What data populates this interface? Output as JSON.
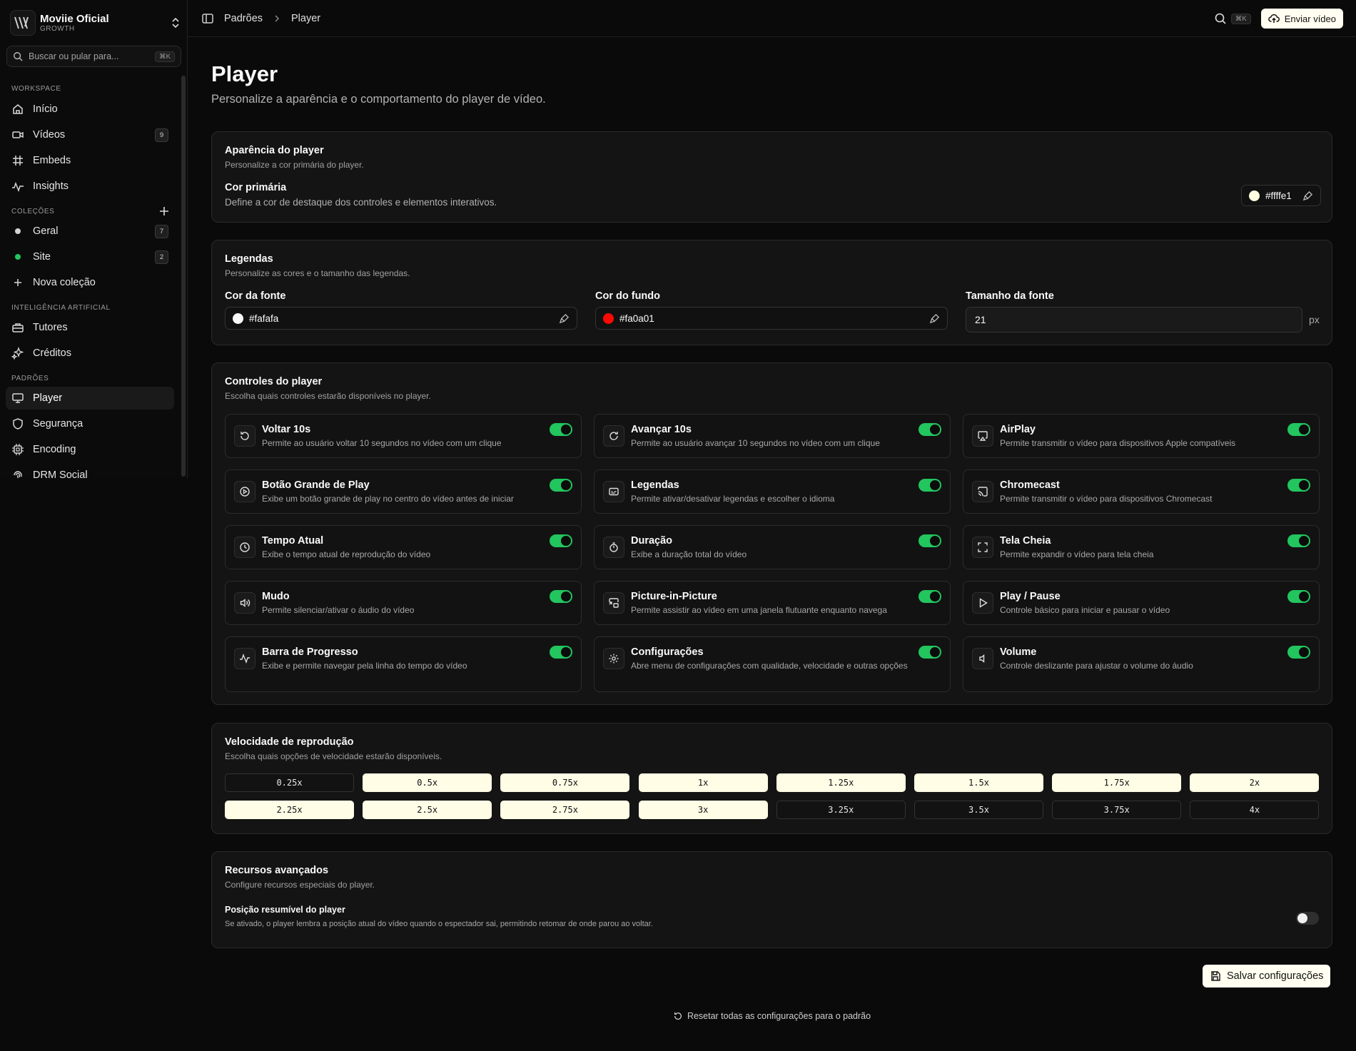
{
  "brand": {
    "name": "Moviie Oficial",
    "plan": "GROWTH"
  },
  "search": {
    "placeholder": "Buscar ou pular para...",
    "shortcut": "⌘K"
  },
  "sidebar": {
    "workspace_label": "WORKSPACE",
    "workspace": [
      {
        "label": "Início",
        "icon": "home-icon"
      },
      {
        "label": "Vídeos",
        "icon": "video-icon",
        "count": "9"
      },
      {
        "label": "Embeds",
        "icon": "hash-icon"
      },
      {
        "label": "Insights",
        "icon": "activity-icon"
      }
    ],
    "collections_label": "COLEÇÕES",
    "collections": [
      {
        "label": "Geral",
        "count": "7",
        "color": "#d4d4d4"
      },
      {
        "label": "Site",
        "count": "2",
        "color": "#22c55e"
      }
    ],
    "new_collection": "Nova coleção",
    "ai_label": "INTELIGÊNCIA ARTIFICIAL",
    "ai": [
      {
        "label": "Tutores",
        "icon": "briefcase-icon"
      },
      {
        "label": "Créditos",
        "icon": "sparkles-icon"
      }
    ],
    "defaults_label": "PADRÕES",
    "defaults": [
      {
        "label": "Player",
        "icon": "monitor-icon",
        "active": true
      },
      {
        "label": "Segurança",
        "icon": "shield-icon"
      },
      {
        "label": "Encoding",
        "icon": "cpu-icon"
      },
      {
        "label": "DRM Social",
        "icon": "fingerprint-icon"
      }
    ]
  },
  "topbar": {
    "breadcrumb": [
      "Padrões",
      "Player"
    ],
    "shortcut": "⌘K",
    "send_label": "Enviar vídeo"
  },
  "page": {
    "title": "Player",
    "subtitle": "Personalize a aparência e o comportamento do player de vídeo."
  },
  "appearance": {
    "title": "Aparência do player",
    "subtitle": "Personalize a cor primária do player.",
    "field_title": "Cor primária",
    "field_desc": "Define a cor de destaque dos controles e elementos interativos.",
    "primary_color": "#ffffe1"
  },
  "captions": {
    "title": "Legendas",
    "subtitle": "Personalize as cores e o tamanho das legendas.",
    "font_color_label": "Cor da fonte",
    "font_color": "#fafafa",
    "bg_color_label": "Cor do fundo",
    "bg_color": "#fa0a01",
    "font_size_label": "Tamanho da fonte",
    "font_size": "21",
    "font_size_unit": "px"
  },
  "controls": {
    "title": "Controles do player",
    "subtitle": "Escolha quais controles estarão disponíveis no player.",
    "items": [
      {
        "title": "Voltar 10s",
        "desc": "Permite ao usuário voltar 10 segundos no vídeo com um clique",
        "icon": "rotate-ccw-icon",
        "enabled": true
      },
      {
        "title": "Avançar 10s",
        "desc": "Permite ao usuário avançar 10 segundos no vídeo com um clique",
        "icon": "rotate-cw-icon",
        "enabled": true
      },
      {
        "title": "AirPlay",
        "desc": "Permite transmitir o vídeo para dispositivos Apple compatíveis",
        "icon": "airplay-icon",
        "enabled": true
      },
      {
        "title": "Botão Grande de Play",
        "desc": "Exibe um botão grande de play no centro do vídeo antes de iniciar",
        "icon": "play-circle-icon",
        "enabled": true
      },
      {
        "title": "Legendas",
        "desc": "Permite ativar/desativar legendas e escolher o idioma",
        "icon": "captions-icon",
        "enabled": true
      },
      {
        "title": "Chromecast",
        "desc": "Permite transmitir o vídeo para dispositivos Chromecast",
        "icon": "cast-icon",
        "enabled": true
      },
      {
        "title": "Tempo Atual",
        "desc": "Exibe o tempo atual de reprodução do vídeo",
        "icon": "clock-icon",
        "enabled": true
      },
      {
        "title": "Duração",
        "desc": "Exibe a duração total do vídeo",
        "icon": "timer-icon",
        "enabled": true
      },
      {
        "title": "Tela Cheia",
        "desc": "Permite expandir o vídeo para tela cheia",
        "icon": "fullscreen-icon",
        "enabled": true
      },
      {
        "title": "Mudo",
        "desc": "Permite silenciar/ativar o áudio do vídeo",
        "icon": "volume-icon",
        "enabled": true
      },
      {
        "title": "Picture-in-Picture",
        "desc": "Permite assistir ao vídeo em uma janela flutuante enquanto navega",
        "icon": "pip-icon",
        "enabled": true
      },
      {
        "title": "Play / Pause",
        "desc": "Controle básico para iniciar e pausar o vídeo",
        "icon": "play-icon",
        "enabled": true
      },
      {
        "title": "Barra de Progresso",
        "desc": "Exibe e permite navegar pela linha do tempo do vídeo",
        "icon": "activity-icon",
        "enabled": true
      },
      {
        "title": "Configurações",
        "desc": "Abre menu de configurações com qualidade, velocidade e outras opções",
        "icon": "settings-icon",
        "enabled": true
      },
      {
        "title": "Volume",
        "desc": "Controle deslizante para ajustar o volume do áudio",
        "icon": "volume-low-icon",
        "enabled": true
      }
    ]
  },
  "speed": {
    "title": "Velocidade de reprodução",
    "subtitle": "Escolha quais opções de velocidade estarão disponíveis.",
    "options": [
      {
        "label": "0.25x",
        "enabled": false
      },
      {
        "label": "0.5x",
        "enabled": true
      },
      {
        "label": "0.75x",
        "enabled": true
      },
      {
        "label": "1x",
        "enabled": true
      },
      {
        "label": "1.25x",
        "enabled": true
      },
      {
        "label": "1.5x",
        "enabled": true
      },
      {
        "label": "1.75x",
        "enabled": true
      },
      {
        "label": "2x",
        "enabled": true
      },
      {
        "label": "2.25x",
        "enabled": true
      },
      {
        "label": "2.5x",
        "enabled": true
      },
      {
        "label": "2.75x",
        "enabled": true
      },
      {
        "label": "3x",
        "enabled": true
      },
      {
        "label": "3.25x",
        "enabled": false
      },
      {
        "label": "3.5x",
        "enabled": false
      },
      {
        "label": "3.75x",
        "enabled": false
      },
      {
        "label": "4x",
        "enabled": false
      }
    ]
  },
  "advanced": {
    "title": "Recursos avançados",
    "subtitle": "Configure recursos especiais do player.",
    "resume_title": "Posição resumível do player",
    "resume_desc": "Se ativado, o player lembra a posição atual do vídeo quando o espectador sai, permitindo retomar de onde parou ao voltar.",
    "resume_enabled": false
  },
  "actions": {
    "save_label": "Salvar configurações",
    "reset_label": "Resetar todas as configurações para o padrão"
  }
}
